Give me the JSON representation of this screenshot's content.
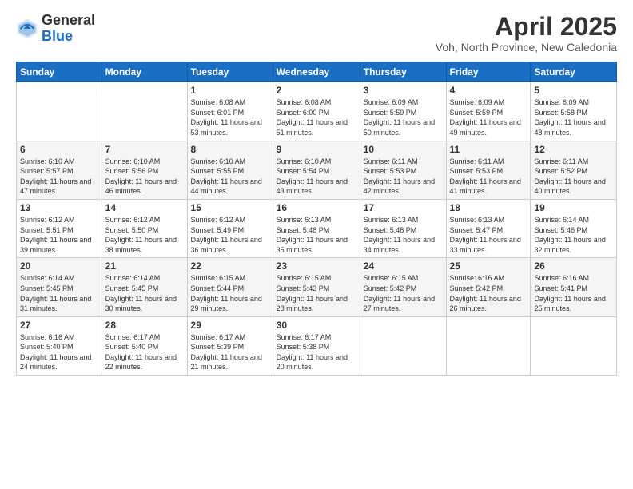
{
  "logo": {
    "general": "General",
    "blue": "Blue"
  },
  "title": {
    "month": "April 2025",
    "location": "Voh, North Province, New Caledonia"
  },
  "weekdays": [
    "Sunday",
    "Monday",
    "Tuesday",
    "Wednesday",
    "Thursday",
    "Friday",
    "Saturday"
  ],
  "weeks": [
    [
      {
        "day": "",
        "info": ""
      },
      {
        "day": "",
        "info": ""
      },
      {
        "day": "1",
        "info": "Sunrise: 6:08 AM\nSunset: 6:01 PM\nDaylight: 11 hours and 53 minutes."
      },
      {
        "day": "2",
        "info": "Sunrise: 6:08 AM\nSunset: 6:00 PM\nDaylight: 11 hours and 51 minutes."
      },
      {
        "day": "3",
        "info": "Sunrise: 6:09 AM\nSunset: 5:59 PM\nDaylight: 11 hours and 50 minutes."
      },
      {
        "day": "4",
        "info": "Sunrise: 6:09 AM\nSunset: 5:59 PM\nDaylight: 11 hours and 49 minutes."
      },
      {
        "day": "5",
        "info": "Sunrise: 6:09 AM\nSunset: 5:58 PM\nDaylight: 11 hours and 48 minutes."
      }
    ],
    [
      {
        "day": "6",
        "info": "Sunrise: 6:10 AM\nSunset: 5:57 PM\nDaylight: 11 hours and 47 minutes."
      },
      {
        "day": "7",
        "info": "Sunrise: 6:10 AM\nSunset: 5:56 PM\nDaylight: 11 hours and 46 minutes."
      },
      {
        "day": "8",
        "info": "Sunrise: 6:10 AM\nSunset: 5:55 PM\nDaylight: 11 hours and 44 minutes."
      },
      {
        "day": "9",
        "info": "Sunrise: 6:10 AM\nSunset: 5:54 PM\nDaylight: 11 hours and 43 minutes."
      },
      {
        "day": "10",
        "info": "Sunrise: 6:11 AM\nSunset: 5:53 PM\nDaylight: 11 hours and 42 minutes."
      },
      {
        "day": "11",
        "info": "Sunrise: 6:11 AM\nSunset: 5:53 PM\nDaylight: 11 hours and 41 minutes."
      },
      {
        "day": "12",
        "info": "Sunrise: 6:11 AM\nSunset: 5:52 PM\nDaylight: 11 hours and 40 minutes."
      }
    ],
    [
      {
        "day": "13",
        "info": "Sunrise: 6:12 AM\nSunset: 5:51 PM\nDaylight: 11 hours and 39 minutes."
      },
      {
        "day": "14",
        "info": "Sunrise: 6:12 AM\nSunset: 5:50 PM\nDaylight: 11 hours and 38 minutes."
      },
      {
        "day": "15",
        "info": "Sunrise: 6:12 AM\nSunset: 5:49 PM\nDaylight: 11 hours and 36 minutes."
      },
      {
        "day": "16",
        "info": "Sunrise: 6:13 AM\nSunset: 5:48 PM\nDaylight: 11 hours and 35 minutes."
      },
      {
        "day": "17",
        "info": "Sunrise: 6:13 AM\nSunset: 5:48 PM\nDaylight: 11 hours and 34 minutes."
      },
      {
        "day": "18",
        "info": "Sunrise: 6:13 AM\nSunset: 5:47 PM\nDaylight: 11 hours and 33 minutes."
      },
      {
        "day": "19",
        "info": "Sunrise: 6:14 AM\nSunset: 5:46 PM\nDaylight: 11 hours and 32 minutes."
      }
    ],
    [
      {
        "day": "20",
        "info": "Sunrise: 6:14 AM\nSunset: 5:45 PM\nDaylight: 11 hours and 31 minutes."
      },
      {
        "day": "21",
        "info": "Sunrise: 6:14 AM\nSunset: 5:45 PM\nDaylight: 11 hours and 30 minutes."
      },
      {
        "day": "22",
        "info": "Sunrise: 6:15 AM\nSunset: 5:44 PM\nDaylight: 11 hours and 29 minutes."
      },
      {
        "day": "23",
        "info": "Sunrise: 6:15 AM\nSunset: 5:43 PM\nDaylight: 11 hours and 28 minutes."
      },
      {
        "day": "24",
        "info": "Sunrise: 6:15 AM\nSunset: 5:42 PM\nDaylight: 11 hours and 27 minutes."
      },
      {
        "day": "25",
        "info": "Sunrise: 6:16 AM\nSunset: 5:42 PM\nDaylight: 11 hours and 26 minutes."
      },
      {
        "day": "26",
        "info": "Sunrise: 6:16 AM\nSunset: 5:41 PM\nDaylight: 11 hours and 25 minutes."
      }
    ],
    [
      {
        "day": "27",
        "info": "Sunrise: 6:16 AM\nSunset: 5:40 PM\nDaylight: 11 hours and 24 minutes."
      },
      {
        "day": "28",
        "info": "Sunrise: 6:17 AM\nSunset: 5:40 PM\nDaylight: 11 hours and 22 minutes."
      },
      {
        "day": "29",
        "info": "Sunrise: 6:17 AM\nSunset: 5:39 PM\nDaylight: 11 hours and 21 minutes."
      },
      {
        "day": "30",
        "info": "Sunrise: 6:17 AM\nSunset: 5:38 PM\nDaylight: 11 hours and 20 minutes."
      },
      {
        "day": "",
        "info": ""
      },
      {
        "day": "",
        "info": ""
      },
      {
        "day": "",
        "info": ""
      }
    ]
  ]
}
